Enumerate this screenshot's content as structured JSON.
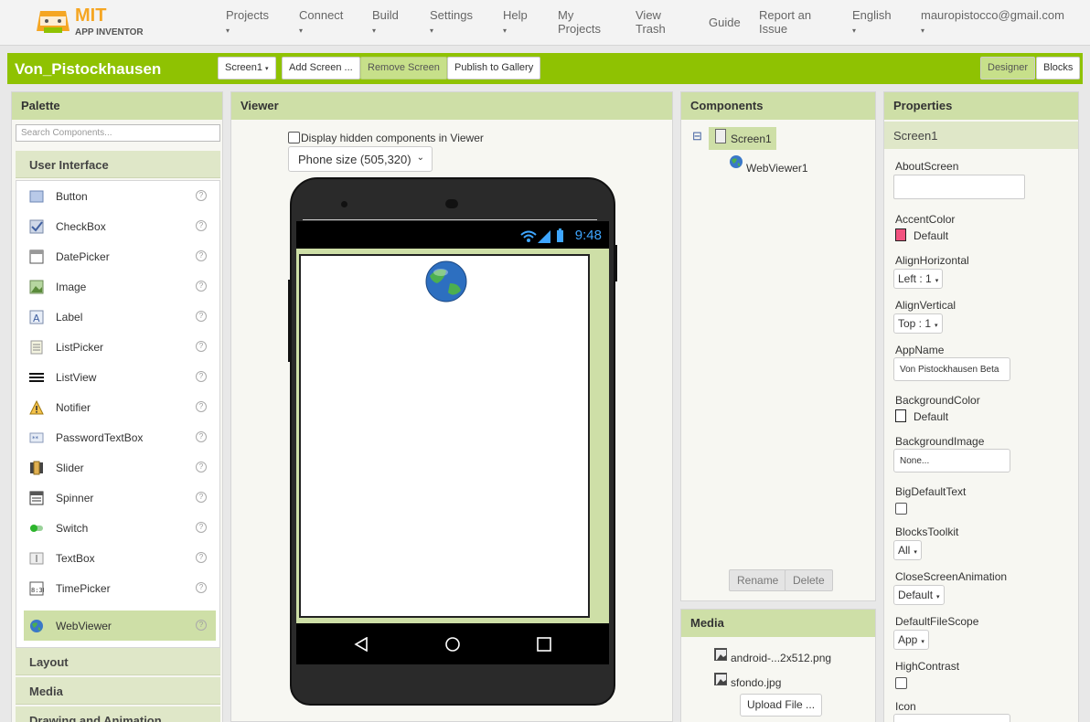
{
  "app": {
    "logo_text": "MIT",
    "logo_sub": "APP INVENTOR"
  },
  "nav": {
    "projects": "Projects",
    "connect": "Connect",
    "build": "Build",
    "settings": "Settings",
    "help": "Help",
    "my_projects": "My Projects",
    "view_trash": "View Trash",
    "guide": "Guide",
    "report_issue": "Report an Issue",
    "language": "English",
    "user": "mauropistocco@gmail.com",
    "caret": "▾"
  },
  "toolbar": {
    "project_name": "Von_Pistockhausen",
    "screen_select": "Screen1",
    "add_screen": "Add Screen ...",
    "remove_screen": "Remove Screen",
    "publish": "Publish to Gallery",
    "designer": "Designer",
    "blocks": "Blocks"
  },
  "palette": {
    "title": "Palette",
    "search_placeholder": "Search Components...",
    "category_ui": "User Interface",
    "items": [
      {
        "label": "Button",
        "icon": "button-icon"
      },
      {
        "label": "CheckBox",
        "icon": "checkbox-icon"
      },
      {
        "label": "DatePicker",
        "icon": "datepicker-icon"
      },
      {
        "label": "Image",
        "icon": "image-icon"
      },
      {
        "label": "Label",
        "icon": "label-icon"
      },
      {
        "label": "ListPicker",
        "icon": "listpicker-icon"
      },
      {
        "label": "ListView",
        "icon": "listview-icon"
      },
      {
        "label": "Notifier",
        "icon": "notifier-icon"
      },
      {
        "label": "PasswordTextBox",
        "icon": "password-icon"
      },
      {
        "label": "Slider",
        "icon": "slider-icon"
      },
      {
        "label": "Spinner",
        "icon": "spinner-icon"
      },
      {
        "label": "Switch",
        "icon": "switch-icon"
      },
      {
        "label": "TextBox",
        "icon": "textbox-icon"
      },
      {
        "label": "TimePicker",
        "icon": "timepicker-icon"
      },
      {
        "label": "WebViewer",
        "icon": "webviewer-icon"
      }
    ],
    "help_glyph": "?",
    "categories_below": [
      "Layout",
      "Media",
      "Drawing and Animation"
    ]
  },
  "viewer": {
    "title": "Viewer",
    "hidden_label": "Display hidden components in Viewer",
    "phone_size": "Phone size (505,320)",
    "time": "9:48"
  },
  "components": {
    "title": "Components",
    "root": "Screen1",
    "child": "WebViewer1",
    "collapse": "⊟",
    "rename": "Rename",
    "delete": "Delete"
  },
  "media": {
    "title": "Media",
    "files": [
      "android-...2x512.png",
      "sfondo.jpg"
    ],
    "upload": "Upload File ..."
  },
  "properties": {
    "title": "Properties",
    "component": "Screen1",
    "about_label": "AboutScreen",
    "accent_label": "AccentColor",
    "accent_value": "Default",
    "accent_color": "#f2527f",
    "alignh_label": "AlignHorizontal",
    "alignh_value": "Left : 1",
    "alignv_label": "AlignVertical",
    "alignv_value": "Top : 1",
    "appname_label": "AppName",
    "appname_value": "Von Pistockhausen Beta",
    "bgcolor_label": "BackgroundColor",
    "bgcolor_value": "Default",
    "bgimage_label": "BackgroundImage",
    "bgimage_value": "None...",
    "bigtext_label": "BigDefaultText",
    "toolkit_label": "BlocksToolkit",
    "toolkit_value": "All",
    "closeanim_label": "CloseScreenAnimation",
    "closeanim_value": "Default",
    "filescope_label": "DefaultFileScope",
    "filescope_value": "App",
    "highcontrast_label": "HighContrast",
    "icon_label": "Icon"
  },
  "colors": {
    "brand_green": "#8fc202",
    "panel_head": "#cedfa7",
    "logo_orange": "#f5a623"
  }
}
